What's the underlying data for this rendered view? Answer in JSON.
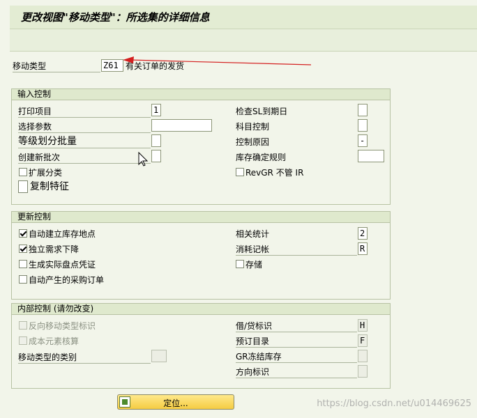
{
  "title": "更改视图\"移动类型\"：所选集的详细信息",
  "movement_type": {
    "label": "移动类型",
    "value": "Z61",
    "description": "有关订单的发货"
  },
  "input_control": {
    "title": "输入控制",
    "print_item": {
      "label": "打印项目",
      "value": "1"
    },
    "selection_param": {
      "label": "选择参数",
      "value": ""
    },
    "batch_split": {
      "label": "等级划分批量",
      "value": ""
    },
    "create_batch": {
      "label": "创建新批次",
      "value": ""
    },
    "ext_classification": {
      "label": "扩展分类",
      "checked": false
    },
    "copy_characteristics": {
      "label": "复制特征",
      "checked": false
    },
    "check_sled": {
      "label": "检查SL到期日",
      "value": ""
    },
    "account_control": {
      "label": "科目控制",
      "value": ""
    },
    "control_reason": {
      "label": "控制原因",
      "value": "-"
    },
    "stock_rule": {
      "label": "库存确定规则",
      "value": ""
    },
    "revgr": {
      "label": "RevGR 不管 IR",
      "checked": false
    }
  },
  "update_control": {
    "title": "更新控制",
    "auto_sloc": {
      "label": "自动建立库存地点",
      "checked": true
    },
    "indep_req": {
      "label": "独立需求下降",
      "checked": true
    },
    "phys_inv_doc": {
      "label": "生成实际盘点凭证",
      "checked": false
    },
    "auto_po": {
      "label": "自动产生的采购订单",
      "checked": false
    },
    "stat_relevant": {
      "label": "相关统计",
      "value": "2"
    },
    "consumption": {
      "label": "消耗记帐",
      "value": "R"
    },
    "store": {
      "label": "存储",
      "checked": false
    }
  },
  "internal_control": {
    "title": "内部控制 (请勿改变)",
    "reverse_ind": {
      "label": "反向移动类型标识",
      "checked": false
    },
    "cost_elem": {
      "label": "成本元素核算",
      "checked": false
    },
    "mvt_category": {
      "label": "移动类型的类别",
      "value": ""
    },
    "debit_credit": {
      "label": "借/贷标识",
      "value": "H"
    },
    "reservation_cat": {
      "label": "预订目录",
      "value": "F"
    },
    "gr_blocked": {
      "label": "GR冻结库存",
      "value": ""
    },
    "direction": {
      "label": "方向标识",
      "value": ""
    }
  },
  "locate_button": {
    "label": "定位..."
  },
  "watermark": "https://blog.csdn.net/u014469625",
  "colors": {
    "arrow": "#d42020",
    "button": "#f5cc42"
  }
}
